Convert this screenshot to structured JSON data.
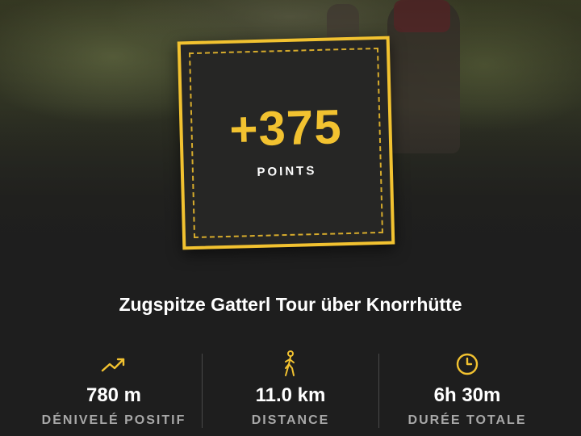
{
  "colors": {
    "accent": "#f2c230",
    "background": "#1e1e1e",
    "caption": "#a8a8a8"
  },
  "badge": {
    "points": "+375",
    "label": "POINTS"
  },
  "tour": {
    "title": "Zugspitze Gatterl Tour über Knorrhütte"
  },
  "stats": [
    {
      "icon": "trending-up-icon",
      "value": "780 m",
      "caption": "DÉNIVELÉ POSITIF"
    },
    {
      "icon": "hiker-icon",
      "value": "11.0 km",
      "caption": "DISTANCE"
    },
    {
      "icon": "clock-icon",
      "value": "6h 30m",
      "caption": "DURÉE TOTALE"
    }
  ]
}
